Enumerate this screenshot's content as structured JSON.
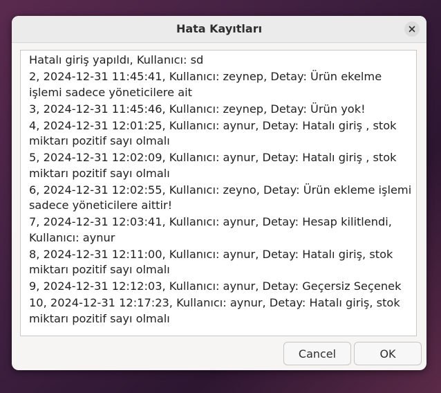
{
  "window": {
    "title": "Hata Kayıtları"
  },
  "log": {
    "entries": [
      "Hatalı giriş yapıldı, Kullanıcı: sd",
      "2, 2024-12-31 11:45:41, Kullanıcı: zeynep, Detay: Ürün ekelme işlemi sadece yöneticilere ait",
      "3, 2024-12-31 11:45:46, Kullanıcı: zeynep, Detay: Ürün yok!",
      "4, 2024-12-31 12:01:25, Kullanıcı: aynur, Detay: Hatalı giriş , stok miktarı pozitif sayı olmalı",
      "5, 2024-12-31 12:02:09, Kullanıcı: aynur, Detay: Hatalı giriş , stok miktarı pozitif sayı olmalı",
      "6, 2024-12-31 12:02:55, Kullanıcı: zeyno, Detay: Ürün ekleme işlemi sadece yöneticilere aittir!",
      "7, 2024-12-31 12:03:41, Kullanıcı: aynur, Detay: Hesap kilitlendi, Kullanıcı: aynur",
      "8, 2024-12-31 12:11:00, Kullanıcı: aynur, Detay: Hatalı giriş, stok miktarı pozitif sayı olmalı",
      "9, 2024-12-31 12:12:03, Kullanıcı: aynur, Detay: Geçersiz Seçenek",
      "10, 2024-12-31 12:17:23, Kullanıcı: aynur, Detay: Hatalı giriş, stok miktarı pozitif sayı olmalı"
    ]
  },
  "buttons": {
    "cancel_label": "Cancel",
    "ok_label": "OK"
  },
  "icons": {
    "close": "close-icon"
  }
}
